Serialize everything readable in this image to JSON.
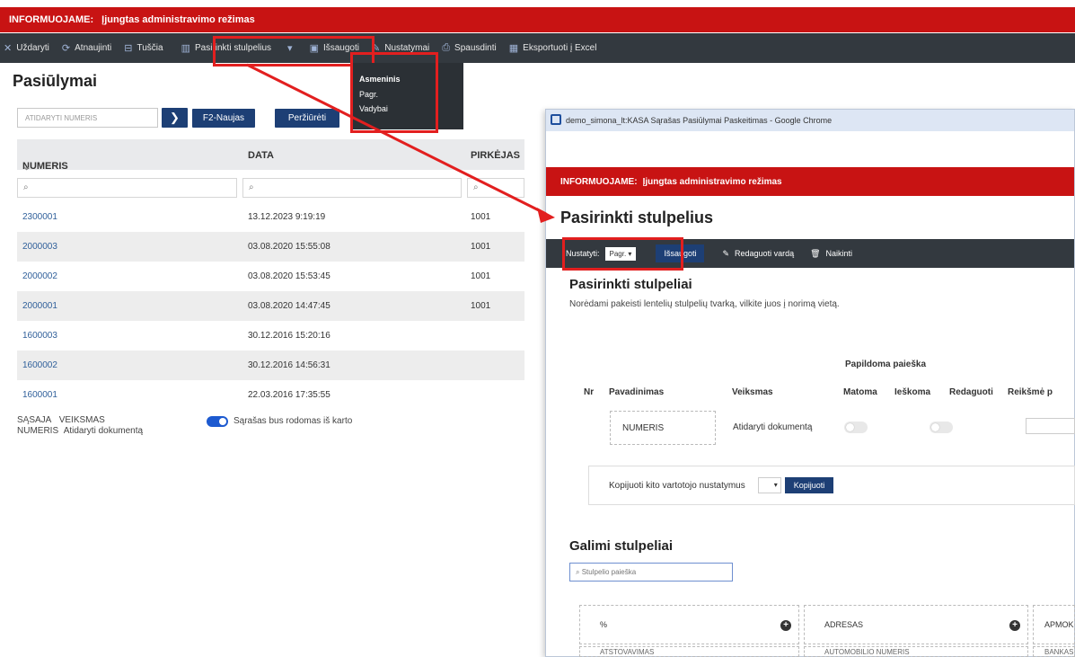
{
  "banner": {
    "label": "INFORMUOJAME:",
    "text": "Įjungtas administravimo režimas"
  },
  "toolbar": {
    "close": "Uždaryti",
    "refresh": "Atnaujinti",
    "empty": "Tuščia",
    "choose_columns": "Pasirinkti stulpelius",
    "save": "Išsaugoti",
    "settings": "Nustatymai",
    "print": "Spausdinti",
    "export": "Eksportuoti į Excel"
  },
  "dropdown": {
    "items": [
      "Asmeninis",
      "Pagr.",
      "Vadybai"
    ]
  },
  "page": {
    "title": "Pasiūlymai",
    "search_placeholder": "ATIDARYTI Numeris",
    "new_button": "F2-Naujas",
    "view_button": "Peržiūrėti"
  },
  "table": {
    "headers": [
      "NUMERIS",
      "DATA",
      "PIRKĖJAS"
    ],
    "rows": [
      [
        "2300001",
        "13.12.2023 9:19:19",
        "1001"
      ],
      [
        "2000003",
        "03.08.2020 15:55:08",
        "1001"
      ],
      [
        "2000002",
        "03.08.2020 15:53:45",
        "1001"
      ],
      [
        "2000001",
        "03.08.2020 14:47:45",
        "1001"
      ],
      [
        "1600003",
        "30.12.2016 15:20:16",
        ""
      ],
      [
        "1600002",
        "30.12.2016 14:56:31",
        ""
      ],
      [
        "1600001",
        "22.03.2016 17:35:55",
        ""
      ]
    ]
  },
  "footer": {
    "col1_h": "SĄSAJA",
    "col2_h": "VEIKSMAS",
    "col1_v": "NUMERIS",
    "col2_v": "Atidaryti dokumentą",
    "toggle_label": "Sąrašas bus rodomas iš karto"
  },
  "popup": {
    "window_title": "demo_simona_lt:KASA Sąrašas Pasiūlymai Paskeitimas - Google Chrome",
    "banner_label": "INFORMUOJAME:",
    "banner_text": "Įjungtas administravimo režimas",
    "title": "Pasirinkti stulpelius",
    "set_label": "Nustatyti:",
    "set_value": "Pagr.",
    "save": "Išsaugoti",
    "rename": "Redaguoti vardą",
    "delete": "Naikinti",
    "section_title": "Pasirinkti stulpeliai",
    "hint": "Norėdami pakeisti lentelių stulpelių tvarką, vilkite juos į norimą vietą.",
    "extra_search": "Papildoma paieška",
    "col_headers": [
      "Nr",
      "Pavadinimas",
      "Veiksmas",
      "Matoma",
      "Ieškoma",
      "Redaguoti",
      "Reikšmė p"
    ],
    "row_name": "NUMERIS",
    "row_action": "Atidaryti dokumentą",
    "copy_label": "Kopijuoti kito vartotojo nustatymus",
    "copy_button": "Kopijuoti",
    "available_title": "Galimi stulpeliai",
    "col_search_placeholder": "Stulpelio paieška",
    "available": [
      "%",
      "ADRESAS",
      "APMOK",
      "ATSTOVAVIMAS",
      "AUTOMOBILIO NUMERIS",
      "BANKAS"
    ]
  }
}
